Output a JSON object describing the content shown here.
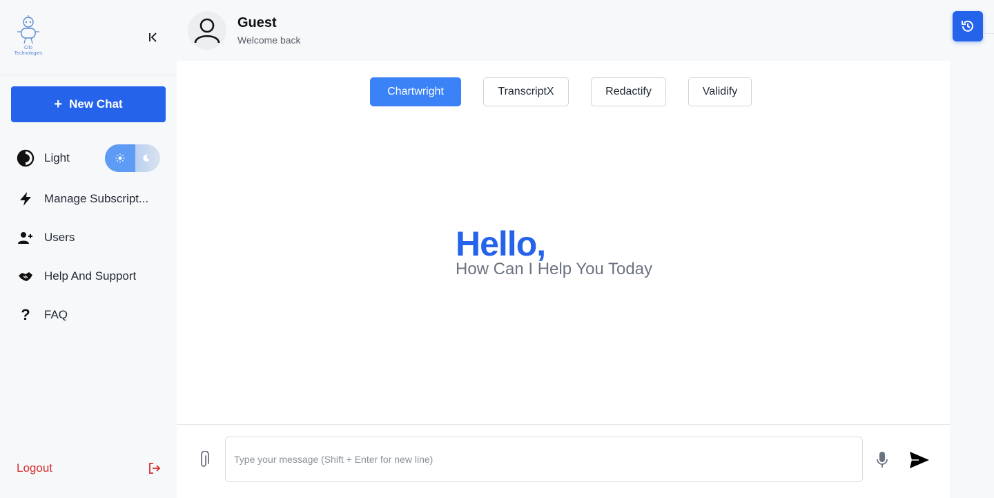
{
  "brand": {
    "logo_line1": "Cilo",
    "logo_line2": "Technologies"
  },
  "sidebar": {
    "new_chat_label": "New Chat",
    "theme_label": "Light",
    "items": [
      {
        "label": "Manage Subscript...",
        "icon": "bolt-icon"
      },
      {
        "label": "Users",
        "icon": "user-plus-icon"
      },
      {
        "label": "Help And Support",
        "icon": "handshake-icon"
      },
      {
        "label": "FAQ",
        "icon": "question-icon"
      }
    ],
    "logout_label": "Logout"
  },
  "header": {
    "user_name": "Guest",
    "user_subtitle": "Welcome back"
  },
  "tabs": [
    {
      "label": "Chartwright",
      "active": true
    },
    {
      "label": "TranscriptX",
      "active": false
    },
    {
      "label": "Redactify",
      "active": false
    },
    {
      "label": "Validify",
      "active": false
    }
  ],
  "greeting": {
    "title": "Hello,",
    "subtitle": "How Can I Help You Today"
  },
  "composer": {
    "placeholder": "Type your message (Shift + Enter for new line)",
    "value": ""
  },
  "colors": {
    "accent": "#2563eb",
    "active_tab": "#3b82f6",
    "logout": "#d62d2d"
  }
}
